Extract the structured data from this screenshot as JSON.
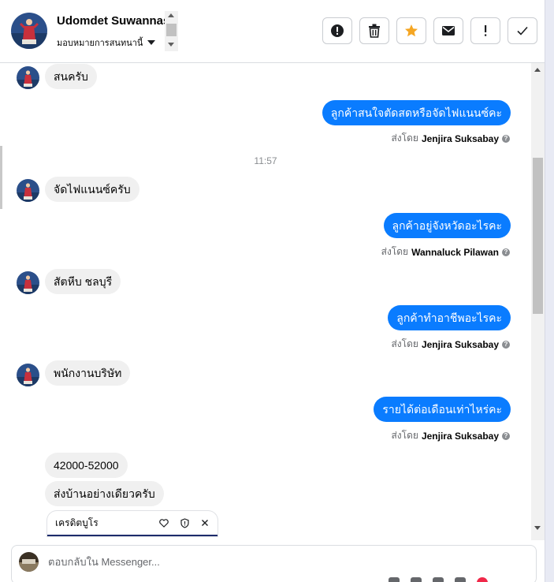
{
  "header": {
    "contact_name": "Udomdet Suwannasri",
    "assign_label": "มอบหมายการสนทนานี้",
    "actions": [
      {
        "name": "report-spam-button",
        "icon": "alert-circle-icon"
      },
      {
        "name": "delete-button",
        "icon": "trash-icon"
      },
      {
        "name": "star-button",
        "icon": "star-icon"
      },
      {
        "name": "mark-unread-button",
        "icon": "envelope-icon"
      },
      {
        "name": "follow-up-button",
        "icon": "exclamation-icon"
      },
      {
        "name": "mark-done-button",
        "icon": "check-icon"
      }
    ]
  },
  "messages": [
    {
      "dir": "in",
      "text": "สนครับ"
    },
    {
      "dir": "out",
      "text": "ลูกค้าสนใจตัดสดหรือจัดไฟแนนซ์คะ",
      "sent_by_prefix": "ส่งโดย",
      "sender": "Jenjira Suksabay"
    },
    {
      "timestamp": "11:57"
    },
    {
      "dir": "in",
      "text": "จัดไฟแนนซ์ครับ"
    },
    {
      "dir": "out",
      "text": "ลูกค้าอยู่จังหวัดอะไรคะ",
      "sent_by_prefix": "ส่งโดย",
      "sender": "Wannaluck Pilawan"
    },
    {
      "dir": "in",
      "text": "สัตหีบ ชลบุรี"
    },
    {
      "dir": "out",
      "text": "ลูกค้าทำอาชีพอะไรคะ",
      "sent_by_prefix": "ส่งโดย",
      "sender": "Jenjira Suksabay"
    },
    {
      "dir": "in",
      "text": "พนักงานบริษัท"
    },
    {
      "dir": "out",
      "text": "รายได้ต่อเดือนเท่าไหร่คะ",
      "sent_by_prefix": "ส่งโดย",
      "sender": "Jenjira Suksabay"
    },
    {
      "dir": "in",
      "text": "42000-52000"
    },
    {
      "dir": "in",
      "text": "ส่งบ้านอย่างเดียวครับ"
    }
  ],
  "tag_chip": {
    "label": "เครดิตบูโร"
  },
  "composer": {
    "placeholder": "ตอบกลับใน Messenger..."
  },
  "colors": {
    "accent": "#0a7cff",
    "incoming_bubble": "#f0f0f0",
    "star": "#f5a623",
    "tag_underline": "#1c2b6b"
  }
}
